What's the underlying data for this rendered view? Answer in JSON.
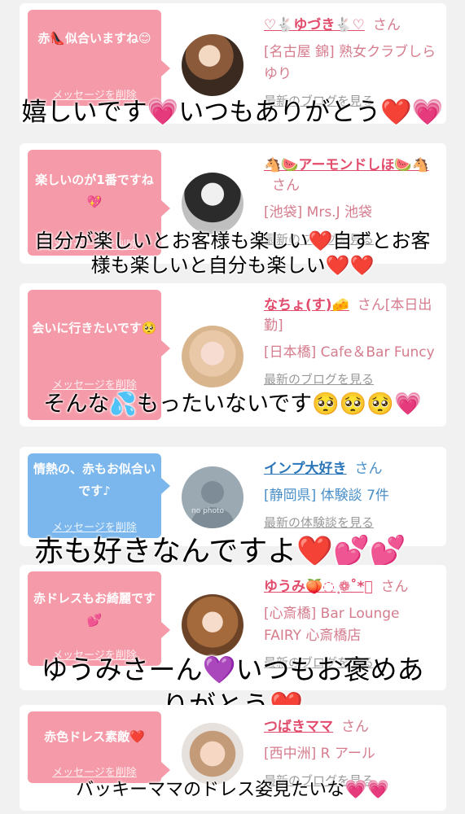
{
  "delete_label": "メッセージを削除",
  "san_label": "さん",
  "cards": [
    {
      "message": "赤👠似合いますね😊",
      "name": "♡🐇ゆづき🐇♡",
      "shop": "[名古屋 錦] 熟女クラブしらゆり",
      "more_link": "最新のブログを見る",
      "caption": "嬉しいです💗いつもありがとう❤️💗"
    },
    {
      "message": "楽しいのが1番ですね💖",
      "name": "🐴🍉アーモンドしほ🍉🐴",
      "shop": "[池袋] Mrs.J 池袋",
      "more_link": "最新のブログを見る",
      "caption_line1": "自分が楽しいとお客様も楽しい❤️自ずとお客",
      "caption_line2": "様も楽しいと自分も楽しい❤️❤️"
    },
    {
      "message": "会いに行きたいです🥺",
      "name": "なちょ(す)🧀",
      "name_tail": "さん[本日出勤]",
      "shop": "[日本橋] Cafe＆Bar Funcy",
      "more_link": "最新のブログを見る",
      "caption": "そんな💦もったいないです🥺🥺🥺💗"
    },
    {
      "message": "情熱の、赤もお似合いです♪",
      "name": "インプ大好き",
      "shop": "[静岡県] 体験談 7件",
      "more_link": "最新の体験談を見る",
      "avatar_text": "no photo",
      "caption": "赤も好きなんですよ❤️💕💕"
    },
    {
      "message": "赤ドレスもお綺麗です💕",
      "name": "ゆうみ🍑◌ ͙❁˚*ﾟ",
      "shop": "[心斎橋] Bar Lounge FAIRY 心斎橋店",
      "more_link": "最新のブログを見る",
      "caption_line1": "ゆうみさーん💜いつもお褒めあ",
      "caption_line2": "りがとう❤️"
    },
    {
      "message": "赤色ドレス素敵❤️",
      "name": "つばきママ",
      "shop": "[西中洲] R アール",
      "more_link": "最新のブログを見る",
      "caption": "バッキーママのドレス姿見たいな💗💗"
    }
  ],
  "colors": {
    "bubble_pink": "#f59aa8",
    "bubble_blue": "#7bb7ec",
    "name_pink": "#e14c6c",
    "name_blue": "#2b76b9"
  }
}
